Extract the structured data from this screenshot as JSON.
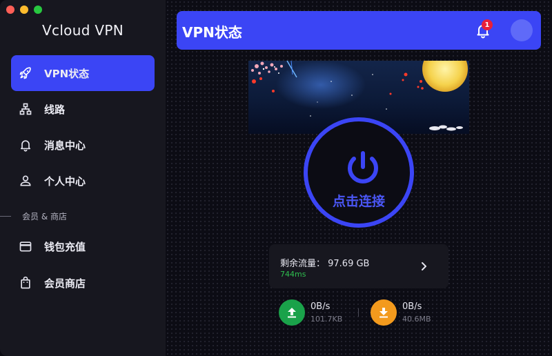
{
  "app": {
    "title": "Vcloud VPN"
  },
  "sidebar": {
    "items": [
      {
        "label": "VPN状态",
        "icon": "rocket-icon",
        "active": true
      },
      {
        "label": "线路",
        "icon": "network-icon",
        "active": false
      },
      {
        "label": "消息中心",
        "icon": "bell-icon",
        "active": false
      },
      {
        "label": "个人中心",
        "icon": "person-icon",
        "active": false
      }
    ],
    "section_label": "会员 & 商店",
    "section_items": [
      {
        "label": "钱包充值",
        "icon": "wallet-icon"
      },
      {
        "label": "会员商店",
        "icon": "shopping-bag-icon"
      }
    ]
  },
  "header": {
    "title": "VPN状态",
    "notification_count": "1"
  },
  "connect": {
    "label": "点击连接"
  },
  "traffic": {
    "remaining": "剩余流量：  97.69 GB",
    "latency": "744ms"
  },
  "upload": {
    "rate": "0B/s",
    "total": "101.7KB"
  },
  "download": {
    "rate": "0B/s",
    "total": "40.6MB"
  },
  "colors": {
    "accent": "#3b45f5",
    "upload": "#1aa24a",
    "download": "#f39a1d",
    "latency": "#2fbf4f",
    "badge": "#e8203a"
  }
}
